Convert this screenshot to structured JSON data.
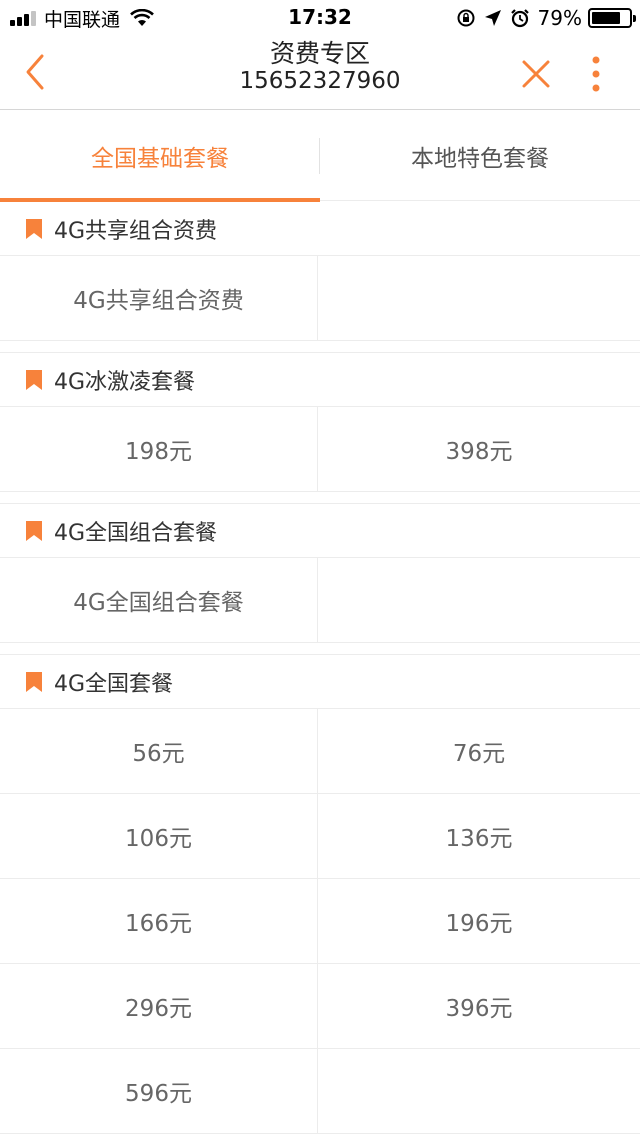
{
  "status_bar": {
    "carrier": "中国联通",
    "time": "17:32",
    "battery": "79%",
    "battery_level": 0.79
  },
  "nav": {
    "title": "资费专区",
    "subtitle": "15652327960"
  },
  "tabs": [
    {
      "label": "全国基础套餐",
      "active": true
    },
    {
      "label": "本地特色套餐",
      "active": false
    }
  ],
  "sections": [
    {
      "title": "4G共享组合资费",
      "items": [
        "4G共享组合资费",
        ""
      ]
    },
    {
      "title": "4G冰激凌套餐",
      "items": [
        "198元",
        "398元"
      ]
    },
    {
      "title": "4G全国组合套餐",
      "items": [
        "4G全国组合套餐",
        ""
      ]
    },
    {
      "title": "4G全国套餐",
      "items": [
        "56元",
        "76元",
        "106元",
        "136元",
        "166元",
        "196元",
        "296元",
        "396元",
        "596元",
        ""
      ]
    }
  ],
  "colors": {
    "accent": "#f7823b"
  }
}
